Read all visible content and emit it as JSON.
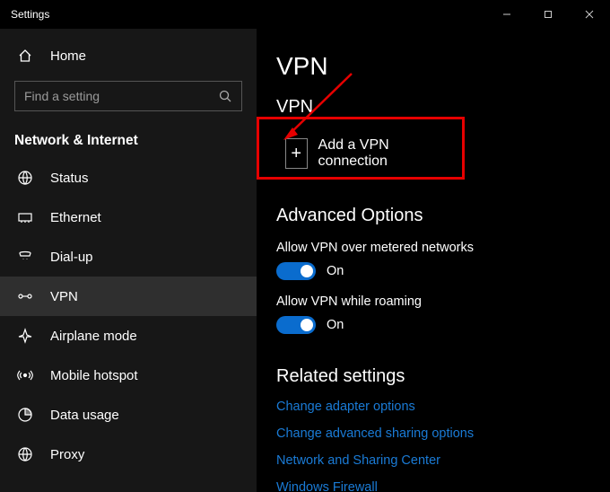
{
  "titlebar": {
    "title": "Settings"
  },
  "sidebar": {
    "home_label": "Home",
    "search_placeholder": "Find a setting",
    "category_label": "Network & Internet",
    "items": [
      {
        "label": "Status"
      },
      {
        "label": "Ethernet"
      },
      {
        "label": "Dial-up"
      },
      {
        "label": "VPN"
      },
      {
        "label": "Airplane mode"
      },
      {
        "label": "Mobile hotspot"
      },
      {
        "label": "Data usage"
      },
      {
        "label": "Proxy"
      }
    ]
  },
  "main": {
    "page_title": "VPN",
    "vpn_section_title": "VPN",
    "add_vpn_label": "Add a VPN connection",
    "advanced_title": "Advanced Options",
    "opt_metered_label": "Allow VPN over metered networks",
    "opt_metered_state": "On",
    "opt_roaming_label": "Allow VPN while roaming",
    "opt_roaming_state": "On",
    "related_title": "Related settings",
    "links": [
      "Change adapter options",
      "Change advanced sharing options",
      "Network and Sharing Center",
      "Windows Firewall"
    ]
  }
}
